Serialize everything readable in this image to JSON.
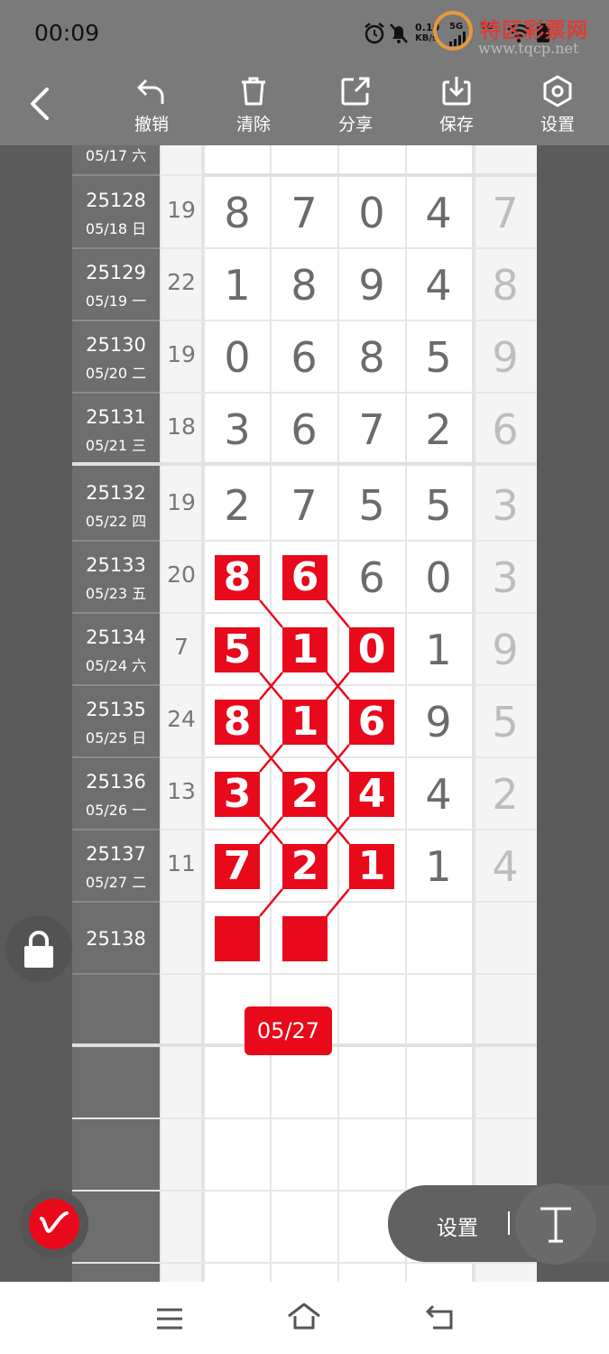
{
  "status_bar": {
    "time": "00:09",
    "net_speed": "0.10",
    "net_unit": "KB/s",
    "sim1": "5G",
    "sim2": "5G"
  },
  "watermark": {
    "brand": "特区彩票网",
    "url": "www.tqcp.net"
  },
  "toolbar": {
    "undo_label": "撤销",
    "clear_label": "清除",
    "share_label": "分享",
    "save_label": "保存",
    "settings_label": "设置"
  },
  "partial_row": {
    "date": "05/17 六"
  },
  "rows": [
    {
      "id": "25128",
      "date": "05/18 日",
      "sum": "19",
      "digits": [
        "8",
        "7",
        "0",
        "4"
      ],
      "extra": "7"
    },
    {
      "id": "25129",
      "date": "05/19 一",
      "sum": "22",
      "digits": [
        "1",
        "8",
        "9",
        "4"
      ],
      "extra": "8"
    },
    {
      "id": "25130",
      "date": "05/20 二",
      "sum": "19",
      "digits": [
        "0",
        "6",
        "8",
        "5"
      ],
      "extra": "9"
    },
    {
      "id": "25131",
      "date": "05/21 三",
      "sum": "18",
      "digits": [
        "3",
        "6",
        "7",
        "2"
      ],
      "extra": "6"
    },
    {
      "id": "25132",
      "date": "05/22 四",
      "sum": "19",
      "digits": [
        "2",
        "7",
        "5",
        "5"
      ],
      "extra": "3"
    },
    {
      "id": "25133",
      "date": "05/23 五",
      "sum": "20",
      "digits": [
        "8",
        "6",
        "6",
        "0"
      ],
      "extra": "3"
    },
    {
      "id": "25134",
      "date": "05/24 六",
      "sum": "7",
      "digits": [
        "5",
        "1",
        "0",
        "1"
      ],
      "extra": "9"
    },
    {
      "id": "25135",
      "date": "05/25 日",
      "sum": "24",
      "digits": [
        "8",
        "1",
        "6",
        "9"
      ],
      "extra": "5"
    },
    {
      "id": "25136",
      "date": "05/26 一",
      "sum": "13",
      "digits": [
        "3",
        "2",
        "4",
        "4"
      ],
      "extra": "2"
    },
    {
      "id": "25137",
      "date": "05/27 二",
      "sum": "11",
      "digits": [
        "7",
        "2",
        "1",
        "1"
      ],
      "extra": "4"
    },
    {
      "id": "25138",
      "date": "",
      "sum": "",
      "digits": [
        "",
        "",
        "",
        ""
      ],
      "extra": ""
    }
  ],
  "date_badge": "05/27",
  "floating": {
    "settings_label": "设置"
  },
  "colors": {
    "accent": "#e8091a",
    "header_gray": "#7a7a7a",
    "id_column": "#6e6e6e"
  }
}
